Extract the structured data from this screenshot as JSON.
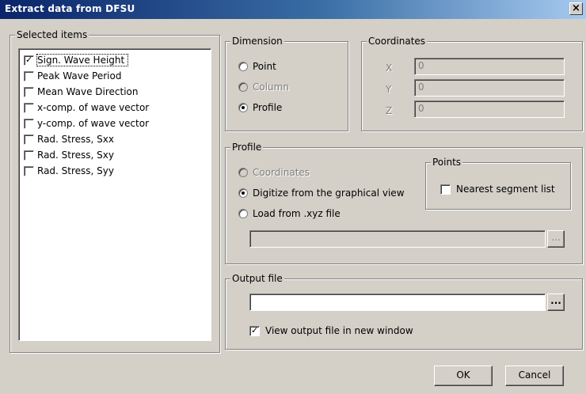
{
  "window": {
    "title": "Extract data from DFSU",
    "close_label": "×"
  },
  "selected_items": {
    "legend": "Selected items",
    "items": [
      {
        "label": "Sign. Wave Height",
        "checked": true
      },
      {
        "label": "Peak Wave Period",
        "checked": false
      },
      {
        "label": "Mean Wave Direction",
        "checked": false
      },
      {
        "label": "x-comp. of wave vector",
        "checked": false
      },
      {
        "label": "y-comp. of wave vector",
        "checked": false
      },
      {
        "label": "Rad. Stress, Sxx",
        "checked": false
      },
      {
        "label": "Rad. Stress, Sxy",
        "checked": false
      },
      {
        "label": "Rad. Stress, Syy",
        "checked": false
      }
    ]
  },
  "dimension": {
    "legend": "Dimension",
    "options": [
      {
        "label": "Point",
        "selected": false,
        "enabled": true
      },
      {
        "label": "Column",
        "selected": false,
        "enabled": false
      },
      {
        "label": "Profile",
        "selected": true,
        "enabled": true
      }
    ]
  },
  "coordinates": {
    "legend": "Coordinates",
    "x_label": "X",
    "x_value": "0",
    "y_label": "Y",
    "y_value": "0",
    "z_label": "Z",
    "z_value": "0"
  },
  "profile": {
    "legend": "Profile",
    "options": [
      {
        "label": "Coordinates",
        "selected": false,
        "enabled": false
      },
      {
        "label": "Digitize from the graphical view",
        "selected": true,
        "enabled": true
      },
      {
        "label": "Load from .xyz file",
        "selected": false,
        "enabled": true
      }
    ],
    "file_value": "",
    "browse_label": "...",
    "points": {
      "legend": "Points",
      "nearest_label": "Nearest segment list",
      "nearest_checked": false
    }
  },
  "output_file": {
    "legend": "Output file",
    "value": "",
    "browse_label": "...",
    "view_label": "View output file in new window",
    "view_checked": true
  },
  "buttons": {
    "ok": "OK",
    "cancel": "Cancel"
  }
}
